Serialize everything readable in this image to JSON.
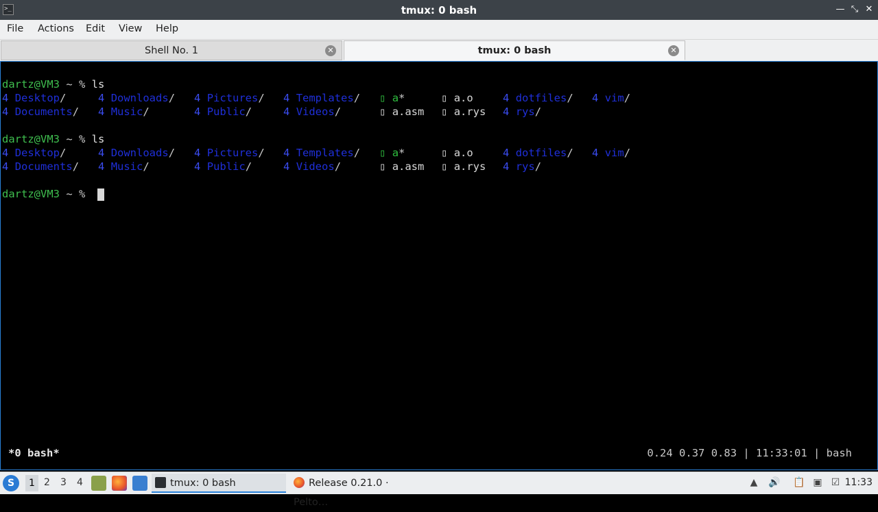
{
  "window": {
    "title": "tmux: 0 bash"
  },
  "menu": [
    "File",
    "Actions",
    "Edit",
    "View",
    "Help"
  ],
  "tabs": [
    {
      "label": "Shell No. 1",
      "active": false
    },
    {
      "label": "tmux: 0 bash",
      "active": true
    }
  ],
  "terminal": {
    "prompt_user": "dartz@VM3",
    "prompt_rest": " ~ % ",
    "command": "ls",
    "listing_row1": [
      {
        "name": "Desktop",
        "kind": "dir"
      },
      {
        "name": "Downloads",
        "kind": "dir"
      },
      {
        "name": "Pictures",
        "kind": "dir"
      },
      {
        "name": "Templates",
        "kind": "dir"
      },
      {
        "name": "a",
        "kind": "exe"
      },
      {
        "name": "a.o",
        "kind": "file"
      },
      {
        "name": "dotfiles",
        "kind": "dir"
      },
      {
        "name": "vim",
        "kind": "dir"
      }
    ],
    "listing_row2": [
      {
        "name": "Documents",
        "kind": "dir"
      },
      {
        "name": "Music",
        "kind": "dir"
      },
      {
        "name": "Public",
        "kind": "dir"
      },
      {
        "name": "Videos",
        "kind": "dir"
      },
      {
        "name": "a.asm",
        "kind": "file"
      },
      {
        "name": "a.rys",
        "kind": "file"
      },
      {
        "name": "rys",
        "kind": "dir"
      }
    ]
  },
  "tmux_status": {
    "left": "*0 bash*",
    "right": "0.24 0.37 0.83 | 11:33:01 | bash"
  },
  "taskbar": {
    "desktops": [
      "1",
      "2",
      "3",
      "4"
    ],
    "active_desktop": "1",
    "tasks": [
      {
        "label": "tmux: 0 bash",
        "icon": "terminal-icon",
        "active": true
      },
      {
        "label": "Release 0.21.0 · Pelto…",
        "icon": "firefox-icon",
        "active": false
      }
    ],
    "clock": "11:33"
  },
  "colors": {
    "accent": "#2a82da",
    "prompt": "#3fbf4f",
    "directory": "#1f2fd9"
  }
}
